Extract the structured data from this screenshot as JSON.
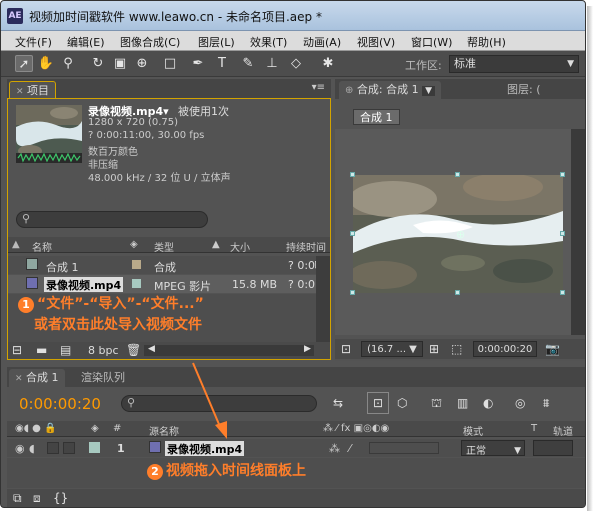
{
  "title": "视频加时间戳软件 www.leawo.cn - 未命名项目.aep *",
  "app_badge": "AE",
  "menu": [
    "文件(F)",
    "编辑(E)",
    "图像合成(C)",
    "图层(L)",
    "效果(T)",
    "动画(A)",
    "视图(V)",
    "窗口(W)",
    "帮助(H)"
  ],
  "workspace": {
    "label": "工作区:",
    "value": "标准"
  },
  "project": {
    "tab": "项目",
    "footage_name": "录像视频.mp4▾",
    "used": "被使用1次",
    "info": [
      "1280 x 720 (0.75)",
      "? 0:00:11:00, 30.00 fps",
      "数百万颜色",
      "非压缩",
      "48.000 kHz / 32 位 U / 立体声"
    ],
    "columns": {
      "name": "名称",
      "type": "类型",
      "size": "大小",
      "duration": "持续时间"
    },
    "items": [
      {
        "name": "合成 1",
        "type": "合成",
        "size": "",
        "duration": "? 0:0"
      },
      {
        "name": "录像视频.mp4",
        "type": "MPEG 影片",
        "size": "15.8 MB",
        "duration": "? 0:0"
      }
    ],
    "bpc": "8 bpc"
  },
  "annotation1": {
    "num": "1",
    "line1": "“文件”-“导入”-“文件...”",
    "line2": "或者双击此处导入视频文件"
  },
  "comp": {
    "tab": "合成: 合成 1",
    "tab2": "图层: (",
    "sub_tab": "合成 1",
    "zoom": "(16.7 ...",
    "time": "0:00:00:20"
  },
  "timeline": {
    "tab": "合成 1",
    "tab2": "渲染队列",
    "time": "0:00:00:20",
    "col_source": "源名称",
    "col_mode": "模式",
    "col_t": "T",
    "col_track": "轨道",
    "layer": {
      "index": "1",
      "name": "录像视频.mp4",
      "mode": "正常"
    }
  },
  "annotation2": {
    "num": "2",
    "text": "视频拖入时间线面板上"
  },
  "colors": {
    "accent": "#ff9a00",
    "annotation": "#ff7e2a",
    "panel_border": "#d2a300"
  }
}
